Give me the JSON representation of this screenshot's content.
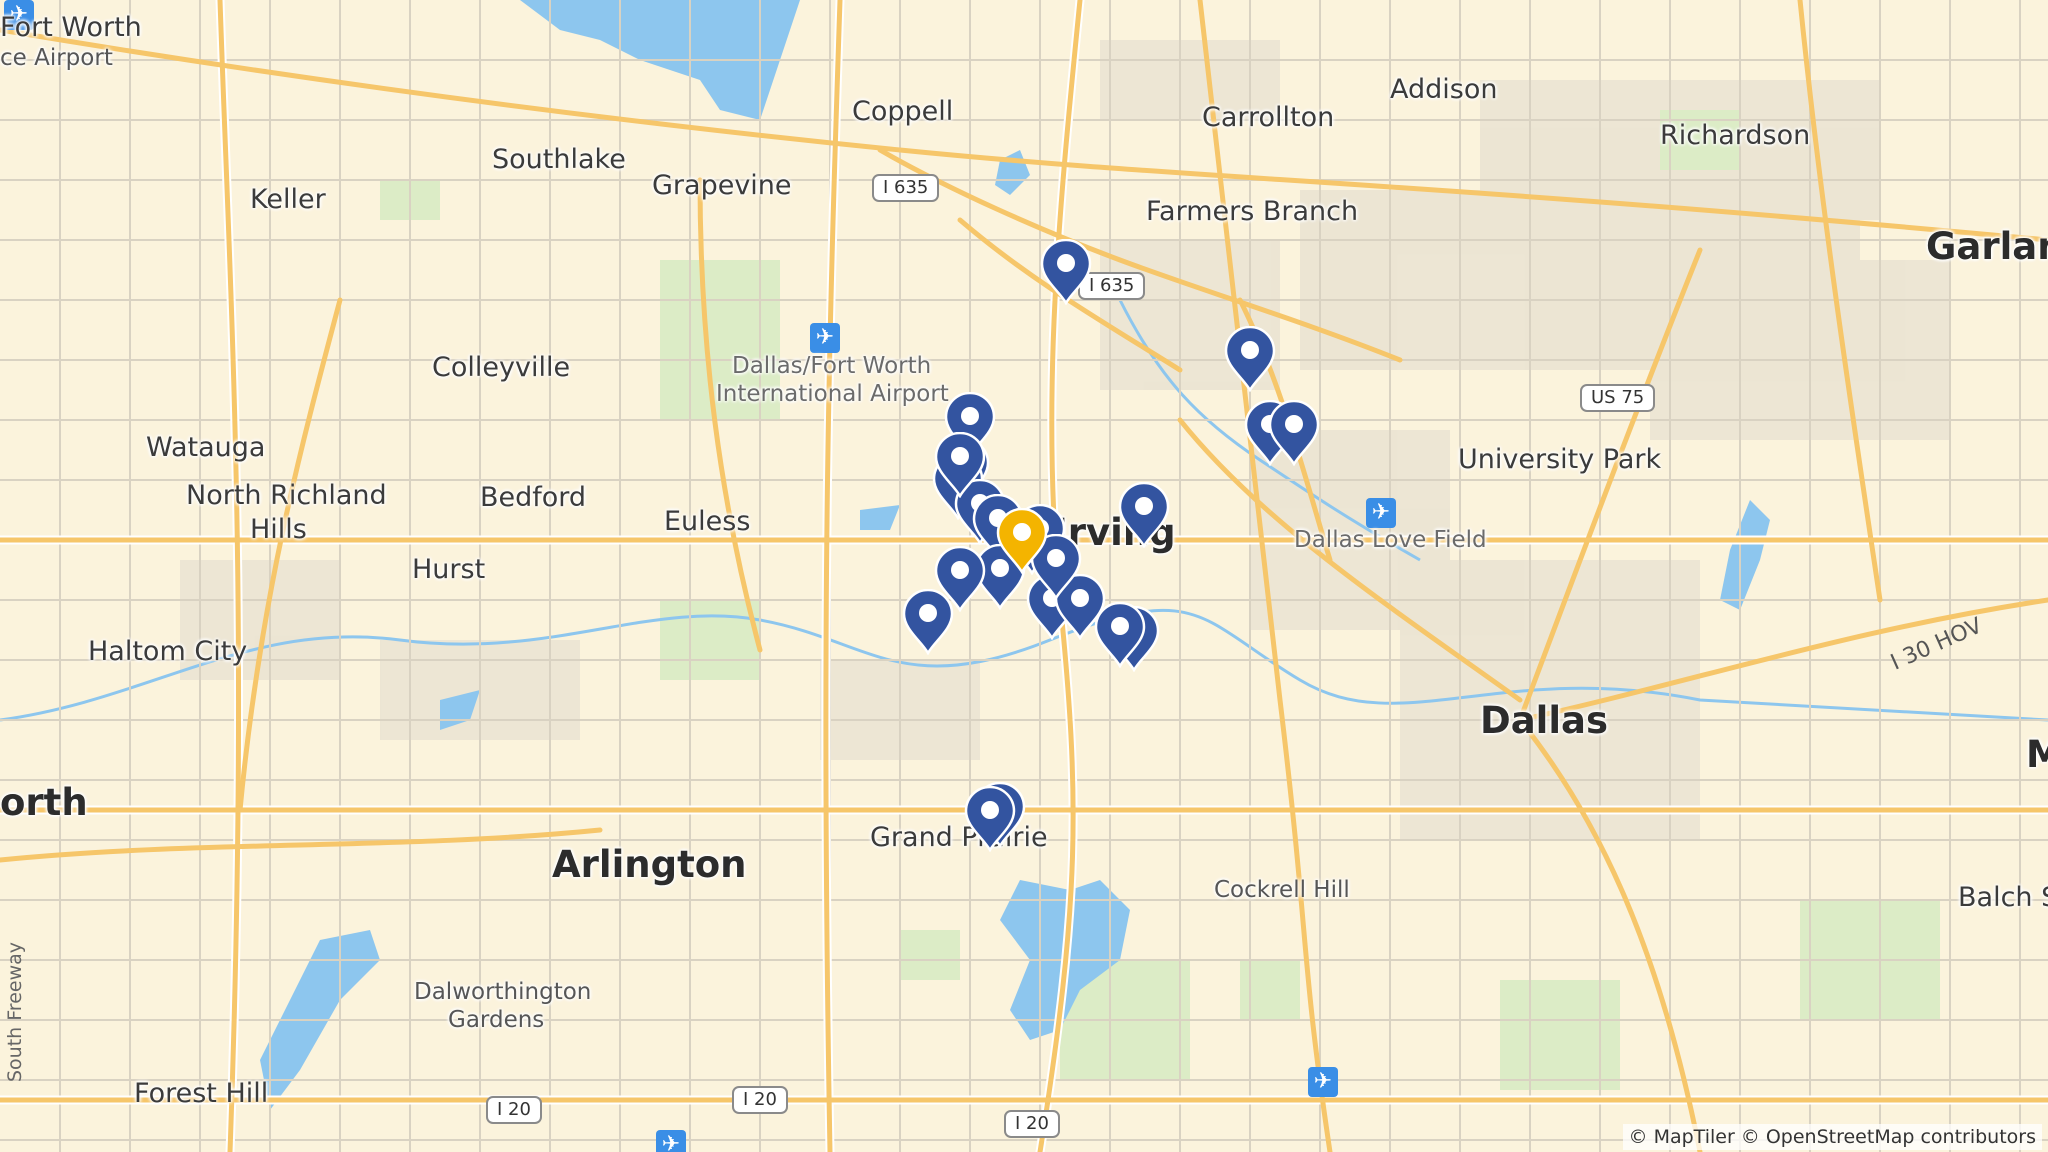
{
  "map": {
    "cities": [
      {
        "id": "fort-worth-airport",
        "text": "Fort Worth",
        "cls": ""
      },
      {
        "id": "fort-worth-airport-2",
        "text": "ce Airport",
        "cls": "small"
      },
      {
        "id": "coppell",
        "text": "Coppell",
        "cls": ""
      },
      {
        "id": "addison",
        "text": "Addison",
        "cls": ""
      },
      {
        "id": "carrollton",
        "text": "Carrollton",
        "cls": ""
      },
      {
        "id": "richardson",
        "text": "Richardson",
        "cls": ""
      },
      {
        "id": "southlake",
        "text": "Southlake",
        "cls": ""
      },
      {
        "id": "grapevine",
        "text": "Grapevine",
        "cls": ""
      },
      {
        "id": "keller",
        "text": "Keller",
        "cls": ""
      },
      {
        "id": "farmers-branch",
        "text": "Farmers Branch",
        "cls": ""
      },
      {
        "id": "garland",
        "text": "Garlan",
        "cls": "big"
      },
      {
        "id": "colleyville",
        "text": "Colleyville",
        "cls": ""
      },
      {
        "id": "watauga",
        "text": "Watauga",
        "cls": ""
      },
      {
        "id": "north-richland-hills-1",
        "text": "North Richland",
        "cls": ""
      },
      {
        "id": "north-richland-hills-2",
        "text": "Hills",
        "cls": ""
      },
      {
        "id": "bedford",
        "text": "Bedford",
        "cls": ""
      },
      {
        "id": "euless",
        "text": "Euless",
        "cls": ""
      },
      {
        "id": "irving",
        "text": "Irving",
        "cls": "big"
      },
      {
        "id": "university-park",
        "text": "University Park",
        "cls": ""
      },
      {
        "id": "hurst",
        "text": "Hurst",
        "cls": ""
      },
      {
        "id": "haltom-city",
        "text": "Haltom City",
        "cls": ""
      },
      {
        "id": "dallas",
        "text": "Dallas",
        "cls": "big"
      },
      {
        "id": "fort-worth",
        "text": "orth",
        "cls": "big"
      },
      {
        "id": "arlington",
        "text": "Arlington",
        "cls": "big"
      },
      {
        "id": "grand-prairie",
        "text": "Grand Prairie",
        "cls": ""
      },
      {
        "id": "cockrell-hill",
        "text": "Cockrell Hill",
        "cls": "small"
      },
      {
        "id": "balch-springs",
        "text": "Balch S",
        "cls": ""
      },
      {
        "id": "mesquite",
        "text": "M",
        "cls": "big"
      },
      {
        "id": "dalworthington-1",
        "text": "Dalworthington",
        "cls": "small"
      },
      {
        "id": "dalworthington-2",
        "text": "Gardens",
        "cls": "small"
      },
      {
        "id": "forest-hill",
        "text": "Forest Hill",
        "cls": ""
      }
    ],
    "airports": [
      {
        "id": "dfw-airport-1",
        "text": "Dallas/Fort Worth"
      },
      {
        "id": "dfw-airport-2",
        "text": "International Airport"
      },
      {
        "id": "love-field",
        "text": "Dallas Love Field"
      }
    ],
    "highway_shields": [
      {
        "id": "i635-north",
        "text": "I 635"
      },
      {
        "id": "i635-central",
        "text": "I 635"
      },
      {
        "id": "us75",
        "text": "US 75"
      },
      {
        "id": "i20-west",
        "text": "I 20"
      },
      {
        "id": "i20-middle",
        "text": "I 20"
      },
      {
        "id": "i20-east",
        "text": "I 20"
      }
    ],
    "road_labels": {
      "hov": "I 30 HOV",
      "south_freeway": "South Freeway"
    },
    "attribution": "© MapTiler © OpenStreetMap contributors",
    "markers": {
      "count_standard": 23,
      "count_highlighted": 1,
      "colors": {
        "standard": "#3354a0",
        "highlighted": "#f4b400"
      }
    }
  }
}
